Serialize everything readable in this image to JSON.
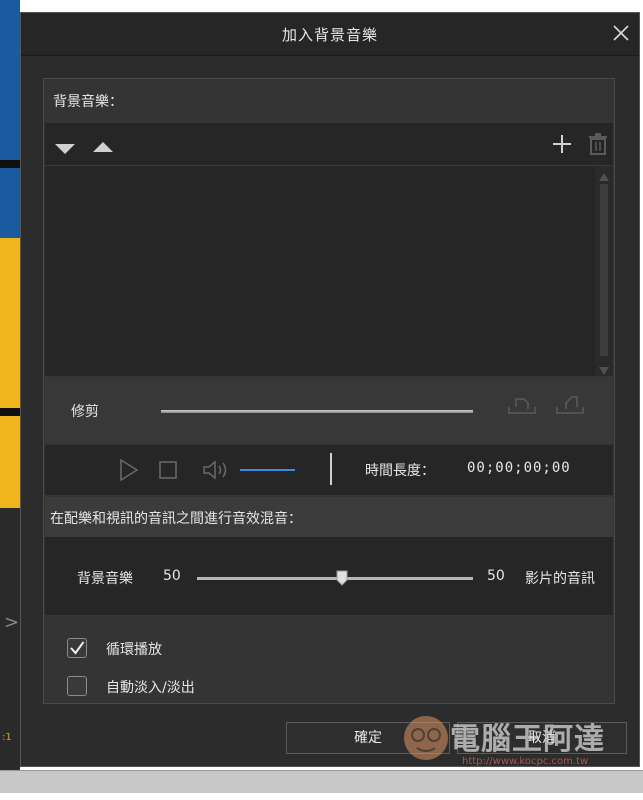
{
  "background": {
    "left_edge_text": ":1"
  },
  "dialog": {
    "title": "加入背景音樂",
    "close_icon": "close-icon",
    "music_section": {
      "label": "背景音樂：",
      "toolbar_icons": [
        "move-down-icon",
        "move-up-icon",
        "add-icon",
        "delete-icon"
      ]
    },
    "trim": {
      "label": "修剪",
      "icons": [
        "trim-start-icon",
        "trim-end-icon"
      ]
    },
    "player": {
      "icons": [
        "play-icon",
        "stop-icon",
        "volume-icon"
      ],
      "duration_label": "時間長度：",
      "duration_value": "00;00;00;00"
    },
    "mix": {
      "header": "在配樂和視訊的音訊之間進行音效混音：",
      "left_label": "背景音樂",
      "left_value": "50",
      "right_value": "50",
      "right_label": "影片的音訊",
      "slider_position": 0.5
    },
    "options": {
      "loop": {
        "label": "循環播放",
        "checked": true
      },
      "fade": {
        "label": "自動淡入/淡出",
        "checked": false
      }
    },
    "buttons": {
      "ok": "確定",
      "cancel": "取消"
    }
  },
  "watermark": {
    "text": "電腦王阿達",
    "url": "http://www.kocpc.com.tw"
  }
}
